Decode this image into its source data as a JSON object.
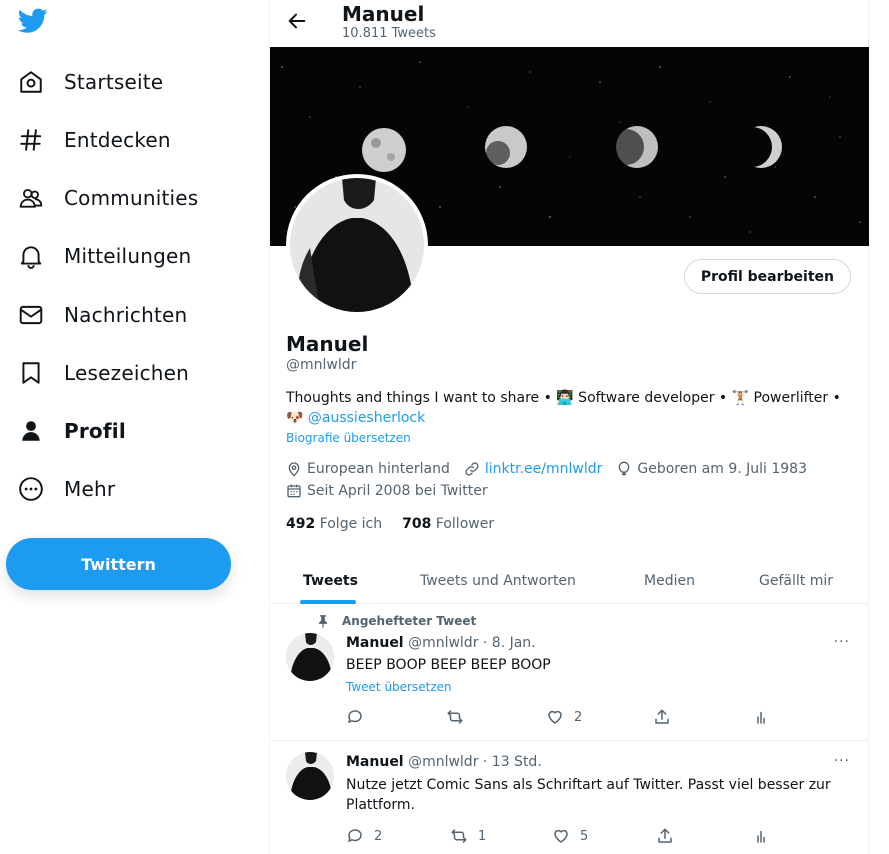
{
  "brand": {
    "color": "#1d9bf0"
  },
  "nav": {
    "items": [
      {
        "label": "Startseite",
        "icon": "home-icon"
      },
      {
        "label": "Entdecken",
        "icon": "hashtag-icon"
      },
      {
        "label": "Communities",
        "icon": "communities-icon"
      },
      {
        "label": "Mitteilungen",
        "icon": "bell-icon"
      },
      {
        "label": "Nachrichten",
        "icon": "mail-icon"
      },
      {
        "label": "Lesezeichen",
        "icon": "bookmark-icon"
      },
      {
        "label": "Profil",
        "icon": "person-icon",
        "active": true
      },
      {
        "label": "Mehr",
        "icon": "more-circle-icon"
      }
    ],
    "tweet_button": "Twittern"
  },
  "header": {
    "name": "Manuel",
    "tweet_count": "10.811 Tweets"
  },
  "profile": {
    "edit_button": "Profil bearbeiten",
    "name": "Manuel",
    "handle": "@mnlwldr",
    "bio_part1": "Thoughts and things I want to share • ",
    "bio_part2": " Software developer • ",
    "bio_part3": " Powerlifter •",
    "bio_mention": "@aussiesherlock",
    "bio_translate": "Biografie übersetzen",
    "location": "European hinterland",
    "link": "linktr.ee/mnlwldr",
    "birthday": "Geboren am 9. Juli 1983",
    "joined": "Seit April 2008 bei Twitter",
    "following_count": "492",
    "following_label": "Folge ich",
    "followers_count": "708",
    "followers_label": "Follower"
  },
  "tabs": [
    "Tweets",
    "Tweets und Antworten",
    "Medien",
    "Gefällt mir"
  ],
  "pinned_label": "Angehefteter Tweet",
  "tweets": [
    {
      "name": "Manuel",
      "meta": "@mnlwldr · 8. Jan.",
      "text": "BEEP BOOP BEEP BEEP BOOP",
      "translate": "Tweet übersetzen",
      "replies": "",
      "retweets": "",
      "likes": "2"
    },
    {
      "name": "Manuel",
      "meta": "@mnlwldr · 13 Std.",
      "text": "Nutze jetzt Comic Sans als Schriftart auf Twitter. Passt viel besser zur Plattform.",
      "replies": "2",
      "retweets": "1",
      "likes": "5"
    }
  ],
  "more_glyph": "···"
}
